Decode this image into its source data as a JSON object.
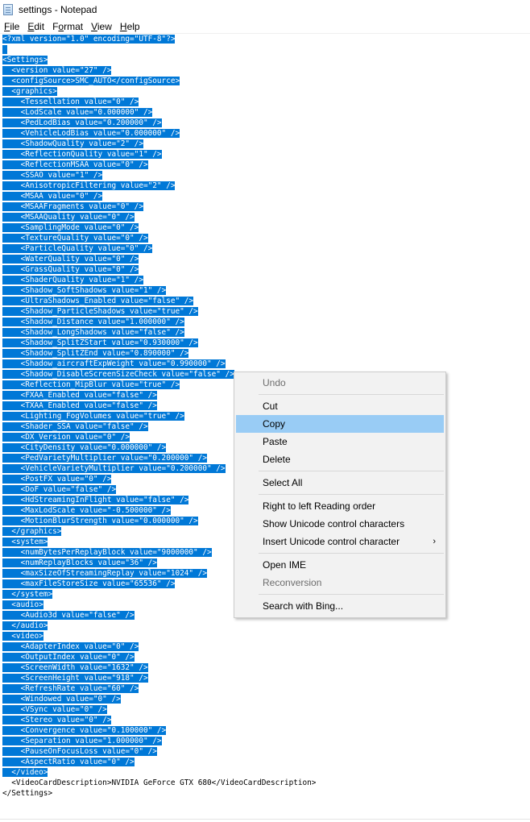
{
  "window": {
    "title": "settings - Notepad"
  },
  "menu": [
    {
      "label": "File",
      "ul": "F",
      "rest": "ile"
    },
    {
      "label": "Edit",
      "ul": "E",
      "rest": "dit"
    },
    {
      "label": "Format",
      "ul": "o",
      "pre": "F",
      "rest": "rmat"
    },
    {
      "label": "View",
      "ul": "V",
      "rest": "iew"
    },
    {
      "label": "Help",
      "ul": "H",
      "rest": "elp"
    }
  ],
  "editor": {
    "lines": [
      {
        "text": "<?xml version=\"1.0\" encoding=\"UTF-8\"?>",
        "sel": true
      },
      {
        "text": "",
        "sel": true
      },
      {
        "text": "<Settings>",
        "sel": true
      },
      {
        "text": "  <version value=\"27\" />",
        "sel": true
      },
      {
        "text": "  <configSource>SMC_AUTO</configSource>",
        "sel": true
      },
      {
        "text": "  <graphics>",
        "sel": true
      },
      {
        "text": "    <Tessellation value=\"0\" />",
        "sel": true
      },
      {
        "text": "    <LodScale value=\"0.000000\" />",
        "sel": true
      },
      {
        "text": "    <PedLodBias value=\"0.200000\" />",
        "sel": true
      },
      {
        "text": "    <VehicleLodBias value=\"0.000000\" />",
        "sel": true
      },
      {
        "text": "    <ShadowQuality value=\"2\" />",
        "sel": true
      },
      {
        "text": "    <ReflectionQuality value=\"1\" />",
        "sel": true
      },
      {
        "text": "    <ReflectionMSAA value=\"0\" />",
        "sel": true
      },
      {
        "text": "    <SSAO value=\"1\" />",
        "sel": true
      },
      {
        "text": "    <AnisotropicFiltering value=\"2\" />",
        "sel": true
      },
      {
        "text": "    <MSAA value=\"0\" />",
        "sel": true
      },
      {
        "text": "    <MSAAFragments value=\"0\" />",
        "sel": true
      },
      {
        "text": "    <MSAAQuality value=\"0\" />",
        "sel": true
      },
      {
        "text": "    <SamplingMode value=\"0\" />",
        "sel": true
      },
      {
        "text": "    <TextureQuality value=\"0\" />",
        "sel": true
      },
      {
        "text": "    <ParticleQuality value=\"0\" />",
        "sel": true
      },
      {
        "text": "    <WaterQuality value=\"0\" />",
        "sel": true
      },
      {
        "text": "    <GrassQuality value=\"0\" />",
        "sel": true
      },
      {
        "text": "    <ShaderQuality value=\"1\" />",
        "sel": true
      },
      {
        "text": "    <Shadow_SoftShadows value=\"1\" />",
        "sel": true
      },
      {
        "text": "    <UltraShadows_Enabled value=\"false\" />",
        "sel": true
      },
      {
        "text": "    <Shadow_ParticleShadows value=\"true\" />",
        "sel": true
      },
      {
        "text": "    <Shadow_Distance value=\"1.000000\" />",
        "sel": true
      },
      {
        "text": "    <Shadow_LongShadows value=\"false\" />",
        "sel": true
      },
      {
        "text": "    <Shadow_SplitZStart value=\"0.930000\" />",
        "sel": true
      },
      {
        "text": "    <Shadow_SplitZEnd value=\"0.890000\" />",
        "sel": true
      },
      {
        "text": "    <Shadow_aircraftExpWeight value=\"0.990000\" />",
        "sel": true
      },
      {
        "text": "    <Shadow_DisableScreenSizeCheck value=\"false\" />",
        "sel": true
      },
      {
        "text": "    <Reflection_MipBlur value=\"true\" />",
        "sel": true
      },
      {
        "text": "    <FXAA_Enabled value=\"false\" />",
        "sel": true
      },
      {
        "text": "    <TXAA_Enabled value=\"false\" />",
        "sel": true
      },
      {
        "text": "    <Lighting_FogVolumes value=\"true\" />",
        "sel": true
      },
      {
        "text": "    <Shader_SSA value=\"false\" />",
        "sel": true
      },
      {
        "text": "    <DX_Version value=\"0\" />",
        "sel": true
      },
      {
        "text": "    <CityDensity value=\"0.000000\" />",
        "sel": true
      },
      {
        "text": "    <PedVarietyMultiplier value=\"0.200000\" />",
        "sel": true
      },
      {
        "text": "    <VehicleVarietyMultiplier value=\"0.200000\" />",
        "sel": true
      },
      {
        "text": "    <PostFX value=\"0\" />",
        "sel": true
      },
      {
        "text": "    <DoF value=\"false\" />",
        "sel": true
      },
      {
        "text": "    <HdStreamingInFlight value=\"false\" />",
        "sel": true
      },
      {
        "text": "    <MaxLodScale value=\"-0.500000\" />",
        "sel": true
      },
      {
        "text": "    <MotionBlurStrength value=\"0.000000\" />",
        "sel": true
      },
      {
        "text": "  </graphics>",
        "sel": true
      },
      {
        "text": "  <system>",
        "sel": true
      },
      {
        "text": "    <numBytesPerReplayBlock value=\"9000000\" />",
        "sel": true
      },
      {
        "text": "    <numReplayBlocks value=\"36\" />",
        "sel": true
      },
      {
        "text": "    <maxSizeOfStreamingReplay value=\"1024\" />",
        "sel": true
      },
      {
        "text": "    <maxFileStoreSize value=\"65536\" />",
        "sel": true
      },
      {
        "text": "  </system>",
        "sel": true
      },
      {
        "text": "  <audio>",
        "sel": true
      },
      {
        "text": "    <Audio3d value=\"false\" />",
        "sel": true
      },
      {
        "text": "  </audio>",
        "sel": true
      },
      {
        "text": "  <video>",
        "sel": true
      },
      {
        "text": "    <AdapterIndex value=\"0\" />",
        "sel": true
      },
      {
        "text": "    <OutputIndex value=\"0\" />",
        "sel": true
      },
      {
        "text": "    <ScreenWidth value=\"1632\" />",
        "sel": true
      },
      {
        "text": "    <ScreenHeight value=\"918\" />",
        "sel": true
      },
      {
        "text": "    <RefreshRate value=\"60\" />",
        "sel": true
      },
      {
        "text": "    <Windowed value=\"0\" />",
        "sel": true
      },
      {
        "text": "    <VSync value=\"0\" />",
        "sel": true
      },
      {
        "text": "    <Stereo value=\"0\" />",
        "sel": true
      },
      {
        "text": "    <Convergence value=\"0.100000\" />",
        "sel": true
      },
      {
        "text": "    <Separation value=\"1.000000\" />",
        "sel": true
      },
      {
        "text": "    <PauseOnFocusLoss value=\"0\" />",
        "sel": true
      },
      {
        "text": "    <AspectRatio value=\"0\" />",
        "sel": true
      },
      {
        "text": "  </video>",
        "sel": true
      },
      {
        "text": "  <VideoCardDescription>NVIDIA GeForce GTX 680</VideoCardDescription>",
        "sel": false
      },
      {
        "text": "</Settings>",
        "sel": false
      }
    ]
  },
  "context_menu": {
    "items": [
      {
        "label": "Undo",
        "disabled": true
      },
      {
        "sep": true
      },
      {
        "label": "Cut"
      },
      {
        "label": "Copy",
        "highlight": true
      },
      {
        "label": "Paste"
      },
      {
        "label": "Delete"
      },
      {
        "sep": true
      },
      {
        "label": "Select All"
      },
      {
        "sep": true
      },
      {
        "label": "Right to left Reading order"
      },
      {
        "label": "Show Unicode control characters"
      },
      {
        "label": "Insert Unicode control character",
        "submenu": true,
        "submenu_icon": "chevron-right-icon"
      },
      {
        "sep": true
      },
      {
        "label": "Open IME"
      },
      {
        "label": "Reconversion",
        "disabled": true
      },
      {
        "sep": true
      },
      {
        "label": "Search with Bing..."
      }
    ]
  },
  "colors": {
    "selection_bg": "#0078d7",
    "selection_fg": "#ffffff",
    "menu_highlight": "#99ccf5",
    "disabled_text": "#6d6d6d"
  }
}
